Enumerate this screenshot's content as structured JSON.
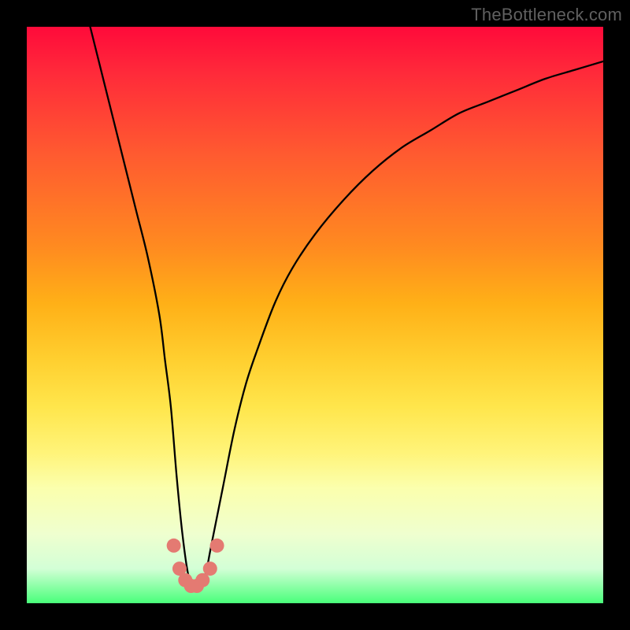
{
  "watermark": "TheBottleneck.com",
  "chart_data": {
    "type": "line",
    "title": "",
    "xlabel": "",
    "ylabel": "",
    "xlim": [
      0,
      100
    ],
    "ylim": [
      0,
      100
    ],
    "grid": false,
    "legend": false,
    "series": [
      {
        "name": "curve",
        "color": "#000000",
        "x": [
          11,
          13,
          15,
          17,
          19,
          21,
          23,
          24,
          25,
          26,
          27,
          28,
          29,
          30,
          31,
          32,
          34,
          36,
          38,
          40,
          43,
          46,
          50,
          55,
          60,
          65,
          70,
          75,
          80,
          85,
          90,
          95,
          100
        ],
        "y": [
          100,
          92,
          84,
          76,
          68,
          60,
          50,
          42,
          34,
          22,
          12,
          5,
          3,
          3,
          5,
          10,
          20,
          30,
          38,
          44,
          52,
          58,
          64,
          70,
          75,
          79,
          82,
          85,
          87,
          89,
          91,
          92.5,
          94
        ]
      },
      {
        "name": "dots",
        "color": "#e47a72",
        "type": "scatter",
        "x": [
          25.5,
          26.5,
          27.5,
          28.5,
          29.5,
          30.5,
          31.8,
          33.0
        ],
        "y": [
          10,
          6,
          4,
          3,
          3,
          4,
          6,
          10
        ]
      }
    ],
    "gradient_stops": [
      {
        "pos": 0.0,
        "color": "#ff0a3a"
      },
      {
        "pos": 0.08,
        "color": "#ff2a3a"
      },
      {
        "pos": 0.22,
        "color": "#ff5a30"
      },
      {
        "pos": 0.38,
        "color": "#ff8a20"
      },
      {
        "pos": 0.48,
        "color": "#ffb017"
      },
      {
        "pos": 0.58,
        "color": "#ffd030"
      },
      {
        "pos": 0.66,
        "color": "#ffe64c"
      },
      {
        "pos": 0.74,
        "color": "#fff47a"
      },
      {
        "pos": 0.8,
        "color": "#fbffad"
      },
      {
        "pos": 0.88,
        "color": "#efffcf"
      },
      {
        "pos": 0.94,
        "color": "#d3ffd6"
      },
      {
        "pos": 1.0,
        "color": "#49ff7a"
      }
    ]
  }
}
